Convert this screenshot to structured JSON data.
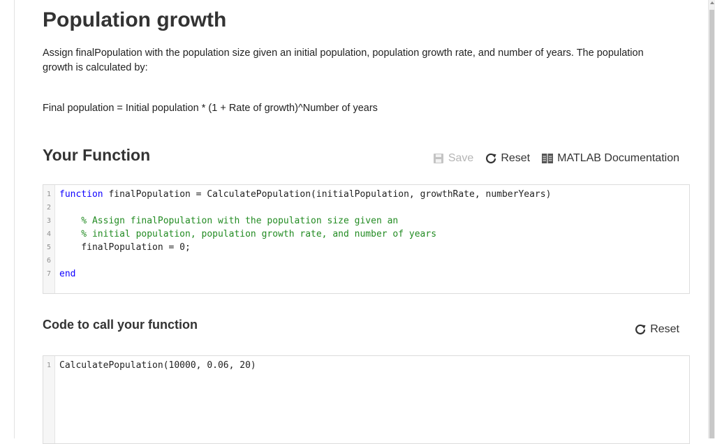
{
  "problem": {
    "title": "Population growth",
    "description": "Assign finalPopulation with the population size given an initial population, population growth rate, and number of years. The population growth is calculated by:",
    "formula": "Final population = Initial population * (1 + Rate of growth)^Number of years"
  },
  "function_section": {
    "heading": "Your Function",
    "toolbar": {
      "save_label": "Save",
      "reset_label": "Reset",
      "docs_label": "MATLAB Documentation"
    },
    "code": {
      "line1_keyword": "function",
      "line1_rest": " finalPopulation = CalculatePopulation(initialPopulation, growthRate, numberYears)",
      "line3_comment": "    % Assign finalPopulation with the population size given an",
      "line4_comment": "    % initial population, population growth rate, and number of years",
      "line5": "    finalPopulation = 0;",
      "line7_keyword": "end"
    },
    "line_numbers": [
      "1",
      "2",
      "3",
      "4",
      "5",
      "6",
      "7"
    ]
  },
  "call_section": {
    "heading": "Code to call your function",
    "reset_label": "Reset",
    "code_line1": "CalculatePopulation(10000, 0.06, 20)",
    "line_numbers": [
      "1"
    ]
  },
  "colors": {
    "keyword": "#0e00ff",
    "comment": "#228b22",
    "disabled": "#b5b5b5"
  },
  "icons": {
    "save": "floppy-disk-icon",
    "reset": "refresh-icon",
    "docs": "book-icon"
  }
}
